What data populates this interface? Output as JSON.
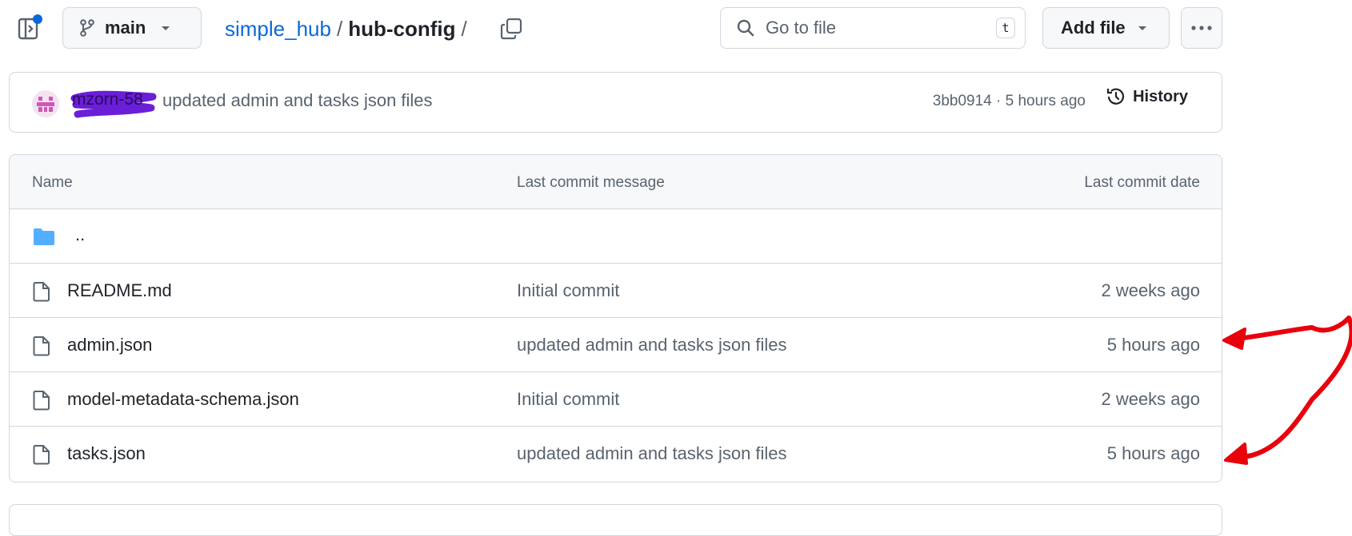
{
  "toolbar": {
    "branch_label": "main",
    "breadcrumb": {
      "repo": "simple_hub",
      "separator": "/",
      "current": "hub-config"
    },
    "search": {
      "placeholder": "Go to file",
      "shortcut": "t"
    },
    "add_file_label": "Add file"
  },
  "commit": {
    "author": "mzorn-58",
    "message": "updated admin and tasks json files",
    "meta": "3bb0914 · 5 hours ago",
    "history_label": "History"
  },
  "table": {
    "headers": {
      "name": "Name",
      "message": "Last commit message",
      "date": "Last commit date"
    },
    "parent_dir": "..",
    "rows": [
      {
        "name": "README.md",
        "message": "Initial commit",
        "date": "2 weeks ago"
      },
      {
        "name": "admin.json",
        "message": "updated admin and tasks json files",
        "date": "5 hours ago"
      },
      {
        "name": "model-metadata-schema.json",
        "message": "Initial commit",
        "date": "2 weeks ago"
      },
      {
        "name": "tasks.json",
        "message": "updated admin and tasks json files",
        "date": "5 hours ago"
      }
    ]
  },
  "colors": {
    "link": "#0969da",
    "folder": "#54aeff",
    "annotation": "#e8000b",
    "redaction": "#6a1ed8"
  },
  "icons": [
    "sidebar-toggle-icon",
    "git-branch-icon",
    "chevron-down-icon",
    "copy-icon",
    "search-icon",
    "kebab-horizontal-icon",
    "history-icon",
    "folder-icon",
    "file-icon"
  ]
}
